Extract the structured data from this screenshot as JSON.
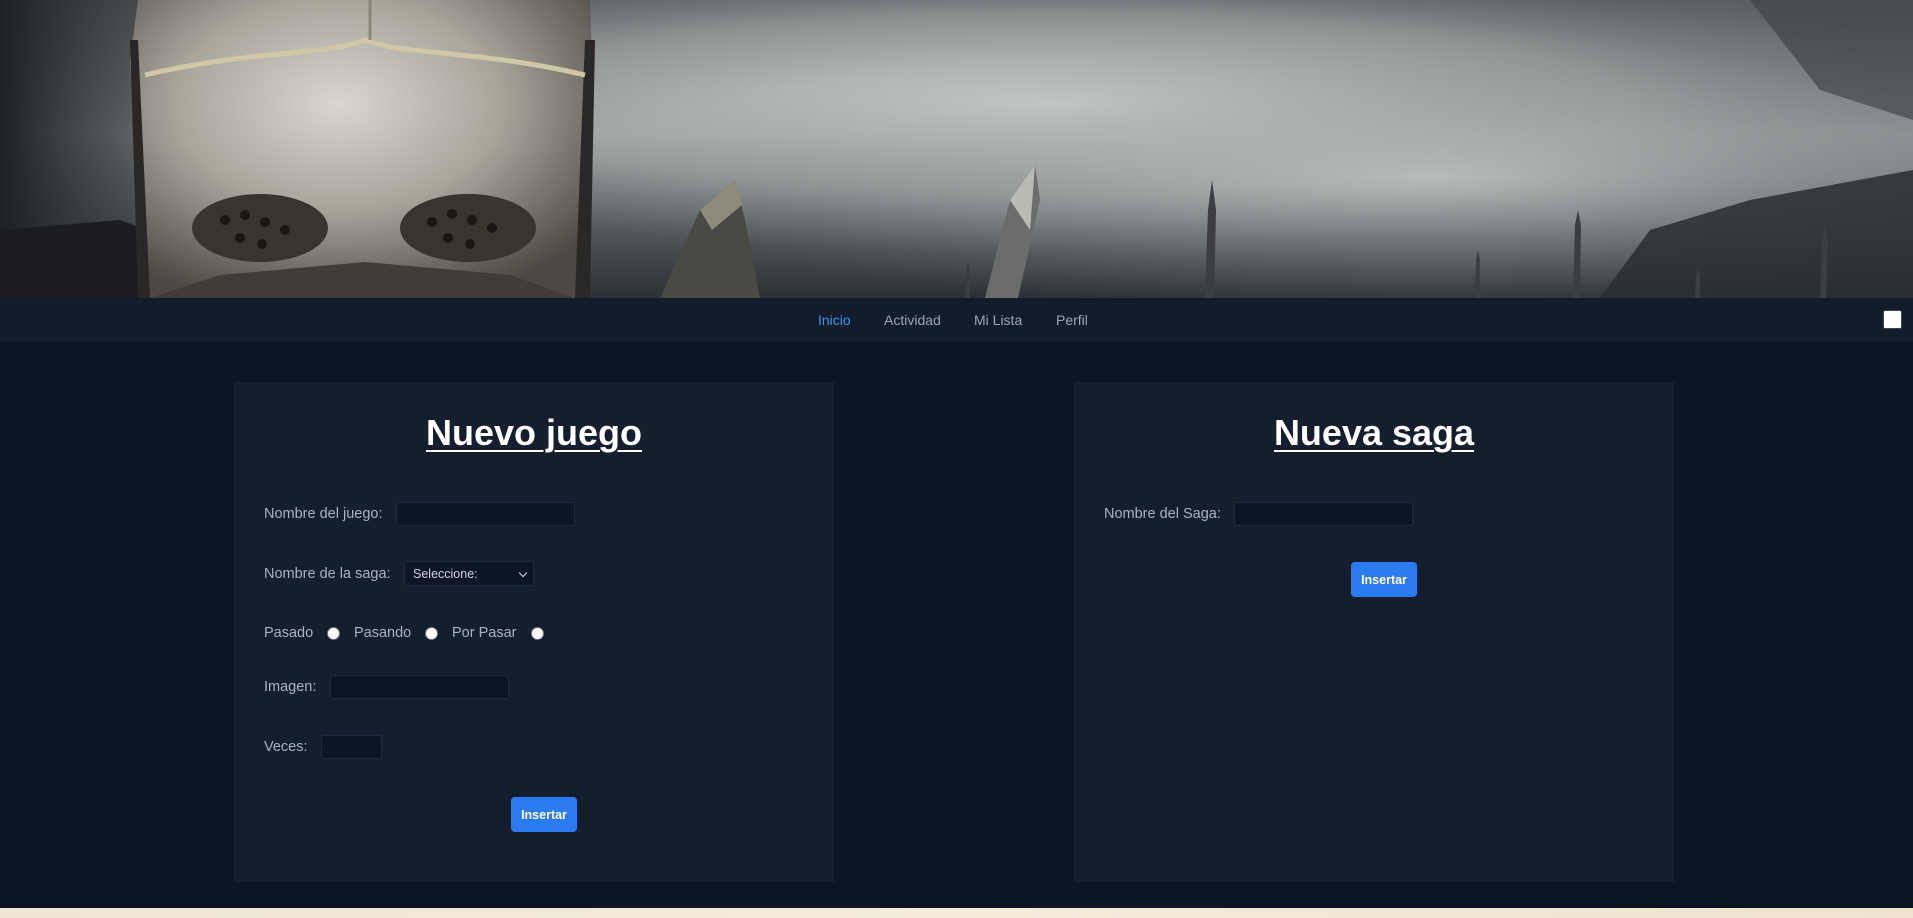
{
  "nav": {
    "items": [
      {
        "label": "Inicio",
        "active": true
      },
      {
        "label": "Actividad",
        "active": false
      },
      {
        "label": "Mi Lista",
        "active": false
      },
      {
        "label": "Perfil",
        "active": false
      }
    ],
    "active_color": "#2e9bf0"
  },
  "game_form": {
    "title": "Nuevo juego",
    "name_label": "Nombre del juego:",
    "name_value": "",
    "saga_label": "Nombre de la saga:",
    "saga_selected": "Seleccione:",
    "status_options": [
      "Pasado",
      "Pasando",
      "Por Pasar"
    ],
    "image_label": "Imagen:",
    "image_value": "",
    "times_label": "Veces:",
    "times_value": "",
    "submit_label": "Insertar"
  },
  "saga_form": {
    "title": "Nueva saga",
    "name_label": "Nombre del Saga:",
    "name_value": "",
    "submit_label": "Insertar"
  },
  "colors": {
    "page_bg": "#0b1422",
    "card_bg": "#141e2f",
    "nav_bg": "#131c2c",
    "button": "#2b7cf0"
  },
  "icons": {
    "theme_toggle": "square-toggle-icon",
    "select": "chevron-down-icon"
  }
}
